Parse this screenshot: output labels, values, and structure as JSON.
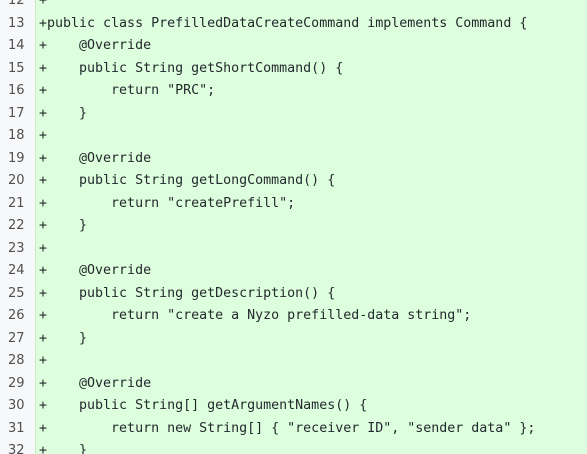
{
  "diff": {
    "lines": [
      {
        "num": "12",
        "text": "+"
      },
      {
        "num": "13",
        "text": "+public class PrefilledDataCreateCommand implements Command {"
      },
      {
        "num": "14",
        "text": "+    @Override"
      },
      {
        "num": "15",
        "text": "+    public String getShortCommand() {"
      },
      {
        "num": "16",
        "text": "+        return \"PRC\";"
      },
      {
        "num": "17",
        "text": "+    }"
      },
      {
        "num": "18",
        "text": "+"
      },
      {
        "num": "19",
        "text": "+    @Override"
      },
      {
        "num": "20",
        "text": "+    public String getLongCommand() {"
      },
      {
        "num": "21",
        "text": "+        return \"createPrefill\";"
      },
      {
        "num": "22",
        "text": "+    }"
      },
      {
        "num": "23",
        "text": "+"
      },
      {
        "num": "24",
        "text": "+    @Override"
      },
      {
        "num": "25",
        "text": "+    public String getDescription() {"
      },
      {
        "num": "26",
        "text": "+        return \"create a Nyzo prefilled-data string\";"
      },
      {
        "num": "27",
        "text": "+    }"
      },
      {
        "num": "28",
        "text": "+"
      },
      {
        "num": "29",
        "text": "+    @Override"
      },
      {
        "num": "30",
        "text": "+    public String[] getArgumentNames() {"
      },
      {
        "num": "31",
        "text": "+        return new String[] { \"receiver ID\", \"sender data\" };"
      },
      {
        "num": "32",
        "text": "+    }"
      }
    ]
  },
  "colors": {
    "added_background": "#ddffdd",
    "gutter_background": "#f7f8fa",
    "text": "#24292e",
    "line_number": "#505050"
  }
}
